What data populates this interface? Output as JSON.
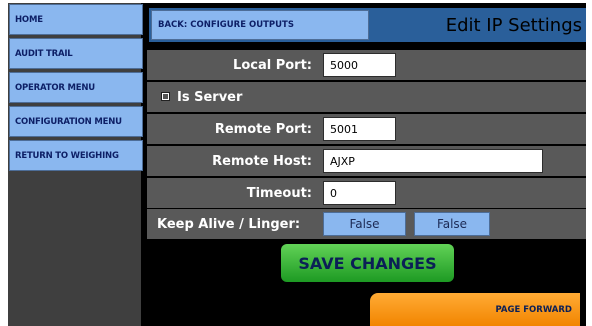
{
  "sidebar": {
    "items": [
      {
        "label": "HOME"
      },
      {
        "label": "AUDIT TRAIL"
      },
      {
        "label": "OPERATOR MENU"
      },
      {
        "label": "CONFIGURATION MENU"
      },
      {
        "label": "RETURN TO WEIGHING"
      }
    ]
  },
  "header": {
    "back_label": "BACK: CONFIGURE OUTPUTS",
    "title": "Edit IP Settings"
  },
  "form": {
    "local_port": {
      "label": "Local Port:",
      "value": "5000"
    },
    "is_server": {
      "label": "Is Server",
      "checked": true
    },
    "remote_port": {
      "label": "Remote Port:",
      "value": "5001"
    },
    "remote_host": {
      "label": "Remote Host:",
      "value": "AJXP"
    },
    "timeout": {
      "label": "Timeout:",
      "value": "0"
    },
    "keep_alive": {
      "label": "Keep Alive / Linger:",
      "keep_alive_value": "False",
      "linger_value": "False"
    }
  },
  "actions": {
    "save_label": "SAVE CHANGES",
    "page_forward_label": "PAGE FORWARD"
  },
  "colors": {
    "nav_button": "#8ab7ef",
    "header_bar": "#2a5f9a",
    "row_bg": "#595959",
    "save_green": "#2fb52f",
    "forward_orange": "#f5930f"
  }
}
